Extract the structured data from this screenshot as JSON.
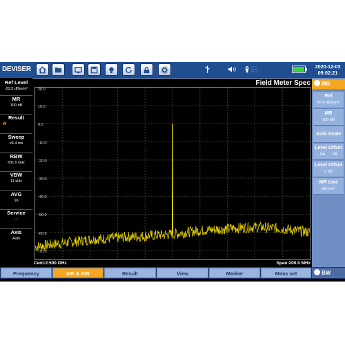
{
  "brand": "DEVISER",
  "datetime": {
    "date": "2020-12-03",
    "time": "09:02:21"
  },
  "toolbar_icons": [
    "home-icon",
    "folder-icon",
    "screen-icon",
    "save-icon",
    "bulb-icon",
    "refresh-icon",
    "lock-icon",
    "settings-icon"
  ],
  "status_icons": [
    "usb-icon",
    "volume-icon",
    "gps-icon",
    "battery-icon"
  ],
  "left_panel": [
    {
      "label": "Ref Level",
      "value": "-22.5 dBm/m²"
    },
    {
      "label": "MR",
      "value": "100 dB"
    },
    {
      "label": "Result",
      "value": "W"
    },
    {
      "label": "Sweep",
      "value": "#4.4 ms"
    },
    {
      "label": "RBW",
      "value": "#31.5 kHz"
    },
    {
      "label": "VBW",
      "value": "11 kHz"
    },
    {
      "label": "AVG",
      "value": "16"
    },
    {
      "label": "Service",
      "value": "---"
    },
    {
      "label": "Axis",
      "value": "Auto"
    }
  ],
  "chart": {
    "title": "Field Meter Spec",
    "center": "Cent:2.500 GHz",
    "span": "Span:200.0 MHz",
    "y_labels": [
      "20.0",
      "10.0",
      "0.0",
      "-10.0",
      "-20.0",
      "-30.0",
      "-40.0",
      "-50.0",
      "-60.0",
      "-70.0"
    ]
  },
  "chart_data": {
    "type": "line",
    "ylim": [
      -75,
      20
    ],
    "xlim": [
      2400,
      2600
    ],
    "series": [
      {
        "x": [
          2400,
          2420,
          2440,
          2460,
          2480,
          2500,
          2520,
          2540,
          2560,
          2580,
          2600
        ],
        "y": [
          -68,
          -66,
          -64,
          -63,
          -62,
          -61,
          -59,
          -58,
          -57,
          -58,
          -60
        ]
      }
    ],
    "peak": {
      "x": 2500,
      "y": 0
    },
    "color": "#e8d400"
  },
  "right_panel": {
    "header": "MR",
    "buttons": [
      {
        "title": "Ref",
        "value": "20.0 dBm/m²"
      },
      {
        "title": "MR",
        "value": "100 dB"
      },
      {
        "title": "Auto Scale",
        "value": ""
      },
      {
        "title": "Level Offset",
        "value": "On      Off"
      },
      {
        "title": "Level Offset",
        "value": "0 dB"
      },
      {
        "title": "MR Unit",
        "value": "dBm/m²"
      }
    ]
  },
  "bottom_tabs": [
    "Frequency",
    "MR & BW",
    "Result",
    "View",
    "Marker",
    "Meas set"
  ],
  "active_tab": "MR & BW",
  "bw_button": "BW",
  "colors": {
    "accent": "#f5a623",
    "topbar": "#1f4e91",
    "trace": "#e8d400"
  }
}
